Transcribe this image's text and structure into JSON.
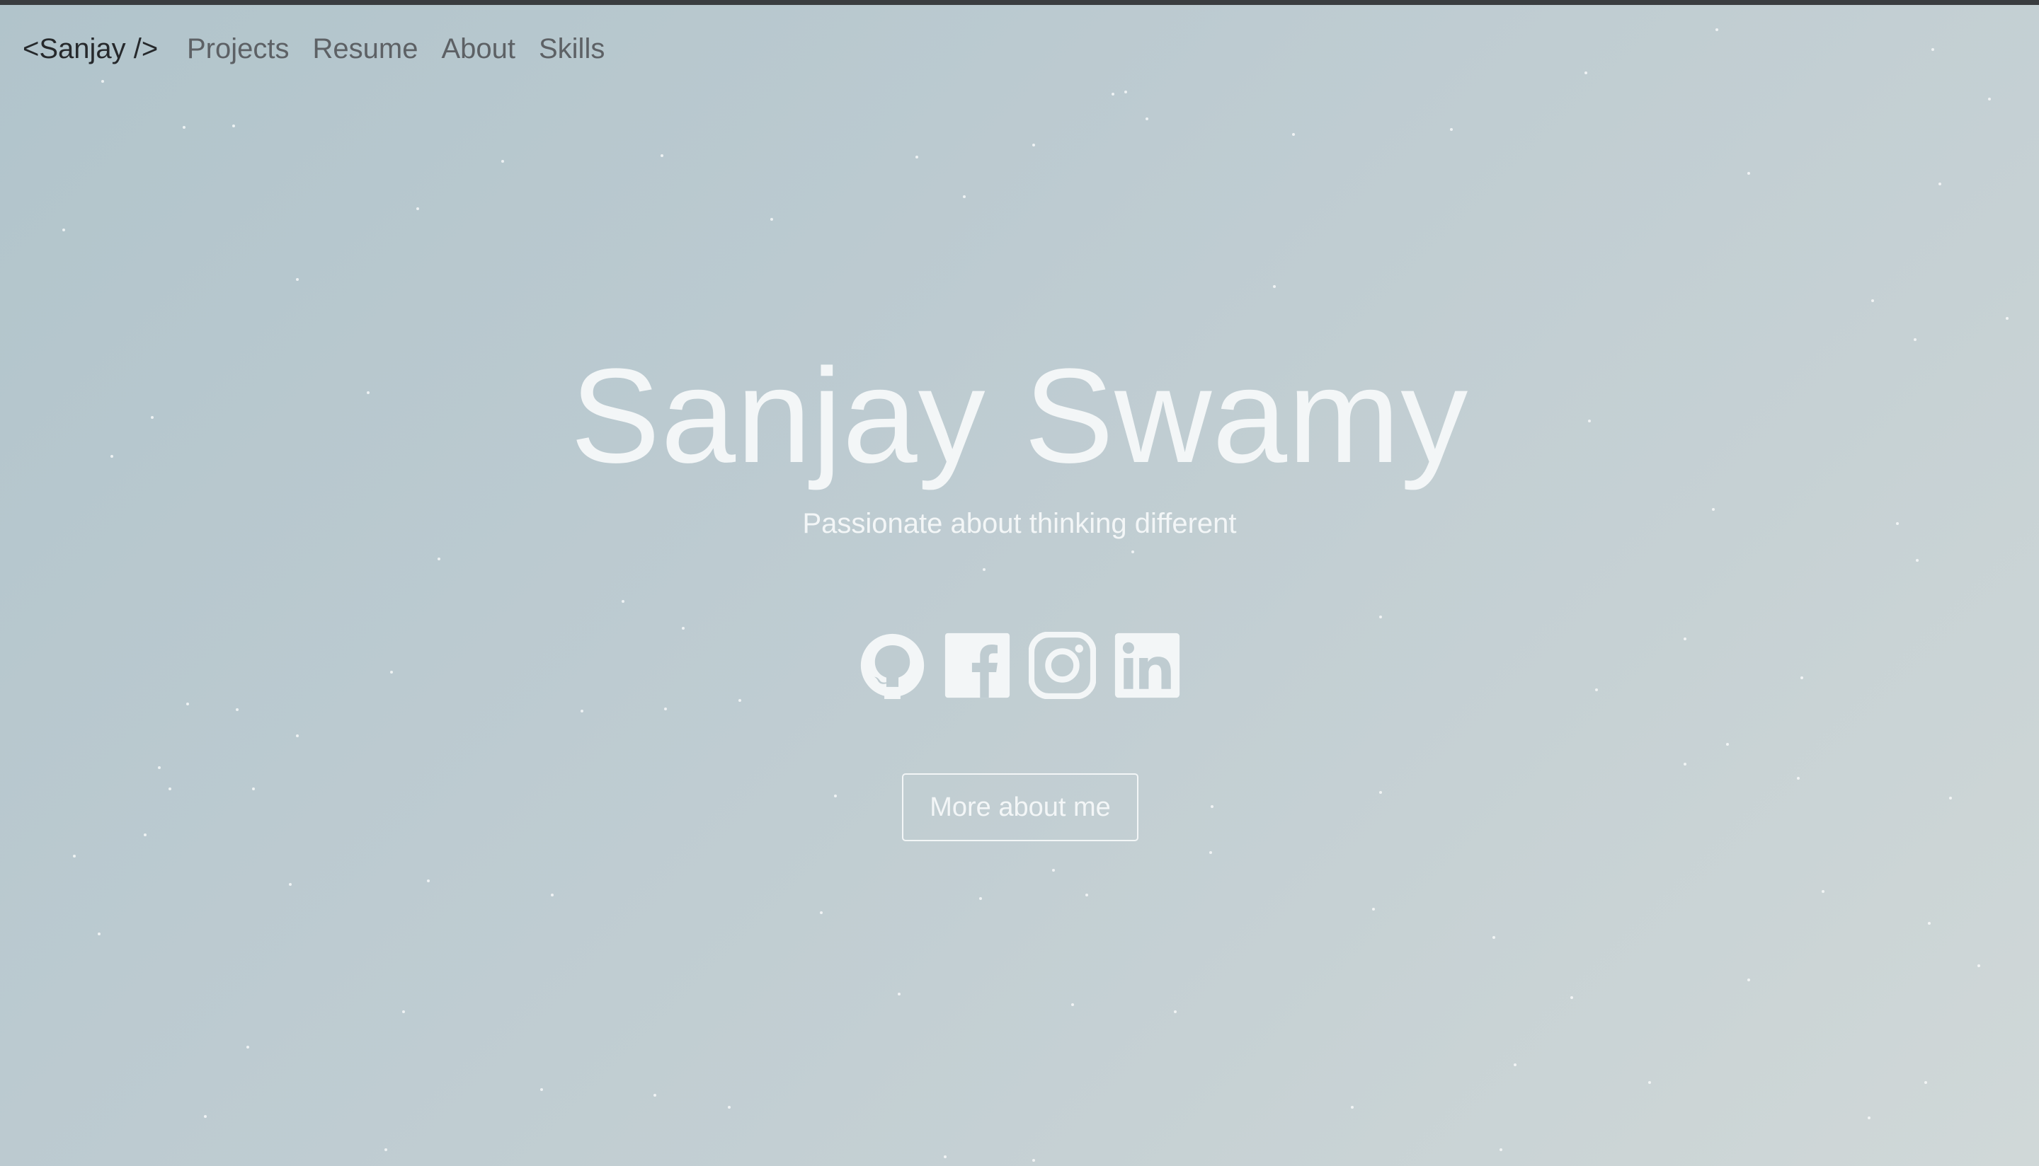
{
  "nav": {
    "brand": "<Sanjay />",
    "links": [
      {
        "label": "Projects"
      },
      {
        "label": "Resume"
      },
      {
        "label": "About"
      },
      {
        "label": "Skills"
      }
    ]
  },
  "hero": {
    "title": "Sanjay Swamy",
    "subtitle": "Passionate about thinking different",
    "social": [
      {
        "icon": "github-icon"
      },
      {
        "icon": "facebook-icon"
      },
      {
        "icon": "instagram-icon"
      },
      {
        "icon": "linkedin-icon"
      }
    ],
    "cta_label": "More about me"
  },
  "colors": {
    "background_start": "#b1c4cb",
    "background_end": "#d0d8d8",
    "hero_text": "#f3f6f7",
    "brand_text": "#26292c",
    "nav_link": "#5d6165"
  }
}
